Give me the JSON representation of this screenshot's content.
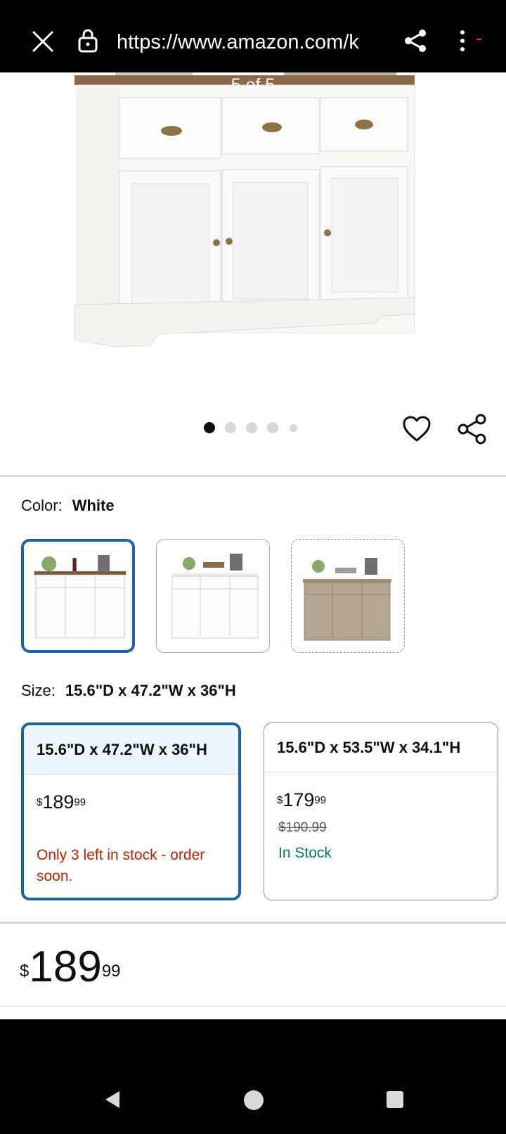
{
  "browser": {
    "url": "https://www.amazon.com/k"
  },
  "gallery": {
    "counter": "5 of 5",
    "dot_count": 5,
    "active_dot": 1
  },
  "color": {
    "label": "Color:",
    "selected": "White",
    "swatches": [
      {
        "name": "white-brown-top",
        "state": "selected"
      },
      {
        "name": "white",
        "state": "available"
      },
      {
        "name": "greige",
        "state": "unavailable"
      }
    ]
  },
  "size": {
    "label": "Size:",
    "selected": "15.6\"D x 47.2\"W x 36\"H",
    "options": [
      {
        "title": "15.6\"D x 47.2\"W x 36\"H",
        "price_symbol": "$",
        "price_whole": "189",
        "price_fraction": "99",
        "availability": "Only 3 left in stock - order soon."
      },
      {
        "title": "15.6\"D x 53.5\"W x 34.1\"H",
        "price_symbol": "$",
        "price_whole": "179",
        "price_fraction": "99",
        "list_price": "$190.99",
        "availability": "In Stock"
      }
    ]
  },
  "price": {
    "symbol": "$",
    "whole": "189",
    "fraction": "99"
  },
  "colors": {
    "selected_border": "#2162a1",
    "low_stock": "#b12704",
    "in_stock": "#067d62"
  }
}
